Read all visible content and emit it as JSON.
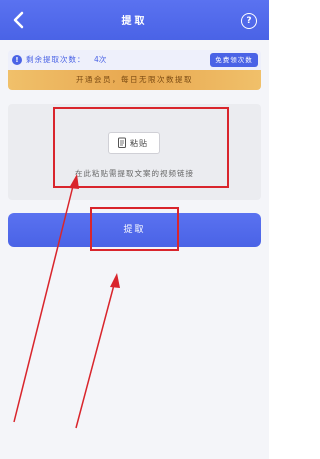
{
  "header": {
    "title": "提取",
    "back_icon": "chevron-left-icon",
    "help_label": "?"
  },
  "info_bar": {
    "label": "剩余提取次数：",
    "count": "4次",
    "free_button": "免费领次数"
  },
  "vip_banner": {
    "text": "开通会员，每日无限次数提取"
  },
  "paste_area": {
    "button_label": "粘贴",
    "hint": "在此粘贴需提取文案的视频链接"
  },
  "extract_button": {
    "label": "提取"
  },
  "colors": {
    "primary": "#4a63e6",
    "gold": "#e8a850",
    "annotation_red": "#d9252c"
  }
}
